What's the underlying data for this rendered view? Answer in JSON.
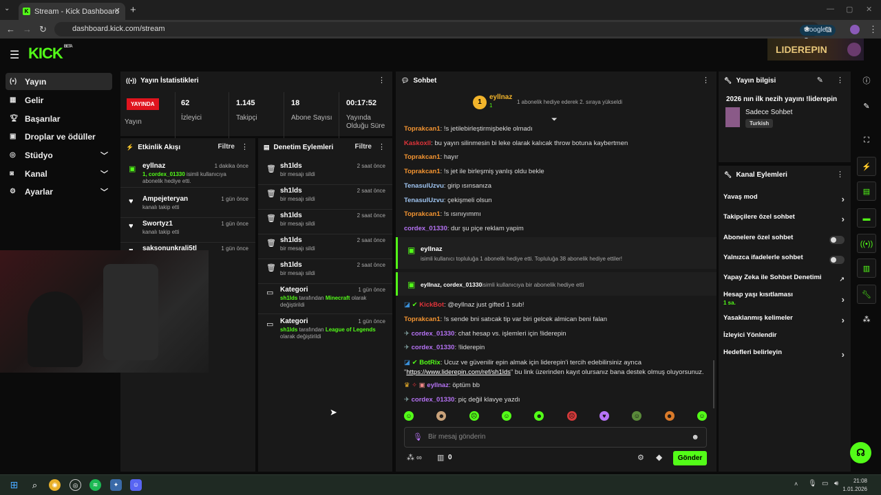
{
  "browser": {
    "tab_title": "Stream - Kick Dashboard",
    "url": "dashboard.kick.com/stream",
    "google_sor": "Google'a Sor"
  },
  "app": {
    "logo": "KICK",
    "logo_beta": "BETA",
    "banner": "LIDEREPIN"
  },
  "sidebar": {
    "items": [
      {
        "label": "Yayın",
        "icon": "broadcast-icon"
      },
      {
        "label": "Gelir",
        "icon": "revenue-icon"
      },
      {
        "label": "Başarılar",
        "icon": "trophy-icon"
      },
      {
        "label": "Droplar ve ödüller",
        "icon": "gift-icon"
      },
      {
        "label": "Stüdyo",
        "icon": "studio-icon"
      },
      {
        "label": "Kanal",
        "icon": "channel-icon"
      },
      {
        "label": "Ayarlar",
        "icon": "gear-icon"
      }
    ]
  },
  "stats": {
    "title": "Yayın İstatistikleri",
    "live_badge": "YAYINDA",
    "live_label": "Yayın",
    "viewers": "62",
    "viewers_label": "İzleyici",
    "followers": "1.145",
    "followers_label": "Takipçi",
    "subs": "18",
    "subs_label": "Abone Sayısı",
    "duration": "00:17:52",
    "duration_label": "Yayında Olduğu Süre"
  },
  "activity": {
    "title": "Etkinlik Akışı",
    "filter": "Filtre",
    "items": [
      {
        "name": "eyllnaz",
        "time": "1 dakika önce",
        "hl": "1, cordex_01330",
        "desc": " isimli kullanıcıya abonelik hediye etti."
      },
      {
        "name": "Ampejeteryan",
        "time": "1 gün önce",
        "hl": "",
        "desc": "kanalı takip etti"
      },
      {
        "name": "Swortyz1",
        "time": "1 gün önce",
        "hl": "",
        "desc": "kanalı takip etti"
      },
      {
        "name": "saksonunkrali5tl",
        "time": "1 gün önce",
        "hl": "",
        "desc": ""
      }
    ]
  },
  "moderation": {
    "title": "Denetim Eylemleri",
    "filter": "Filtre",
    "items": [
      {
        "name": "sh1lds",
        "time": "2 saat önce",
        "desc": "bir mesajı sildi"
      },
      {
        "name": "sh1lds",
        "time": "2 saat önce",
        "desc": "bir mesajı sildi"
      },
      {
        "name": "sh1lds",
        "time": "2 saat önce",
        "desc": "bir mesajı sildi"
      },
      {
        "name": "sh1lds",
        "time": "2 saat önce",
        "desc": "bir mesajı sildi"
      },
      {
        "name": "sh1lds",
        "time": "2 saat önce",
        "desc": "bir mesajı sildi"
      }
    ],
    "categories": [
      {
        "name": "Kategori",
        "time": "1 gün önce",
        "user": "sh1lds",
        "mid": " tarafından ",
        "game": "Minecraft",
        "end": " olarak değiştirildi"
      },
      {
        "name": "Kategori",
        "time": "1 gün önce",
        "user": "sh1lds",
        "mid": " tarafından ",
        "game": "League of Legends",
        "end": " olarak değiştirildi"
      }
    ]
  },
  "chat": {
    "title": "Sohbet",
    "pinned_rank": "1",
    "pinned_user": "eyllnaz",
    "pinned_sub": "1",
    "pinned_text": "1 abonelik hediye ederek 2. sıraya yükseldi",
    "messages": [
      {
        "user": "Toprakcan1",
        "cls": "u-orange",
        "text": ": !s jetilebirleştirmişbekle olmadı"
      },
      {
        "user": "Kaskoxll",
        "cls": "u-red",
        "text": ": bu yayın silinmesin bi leke olarak kalıcak throw botuna kaybertmen"
      },
      {
        "user": "Toprakcan1",
        "cls": "u-orange",
        "text": ": hayır"
      },
      {
        "user": "Toprakcan1",
        "cls": "u-orange",
        "text": ": !s jet ile birleşmiş yanlış oldu bekle"
      },
      {
        "user": "TenasulUzvu",
        "cls": "u-blue",
        "text": ": girip ısınsanıza"
      },
      {
        "user": "TenasulUzvu",
        "cls": "u-blue",
        "text": ": çekişmeli olsun"
      },
      {
        "user": "Toprakcan1",
        "cls": "u-orange",
        "text": ": !s ısınıyımmı"
      },
      {
        "user": "cordex_01330",
        "cls": "u-purple",
        "text": ": dur şu piçe reklam yapim"
      }
    ],
    "gift1_user": "eyllnaz",
    "gift1_text": "isimli kullanıcı topluluğa 1 abonelik hediye etti. Topluluğa 38 abonelik hediye ettiler!",
    "gift2_users": "eyllnaz, cordex_01330",
    "gift2_text": " isimli kullanıcıya bir abonelik hediye etti",
    "messages2": [
      {
        "user": "KickBot",
        "cls": "u-red",
        "text": ": @eyllnaz just gifted 1 sub!"
      },
      {
        "user": "Toprakcan1",
        "cls": "u-orange",
        "text": ": !s sende bni satıcak tip var biri gelcek almican beni falan"
      },
      {
        "user": "cordex_01330",
        "cls": "u-purple",
        "text": ": chat hesap vs. işlemleri için !liderepin"
      },
      {
        "user": "cordex_01330",
        "cls": "u-purple",
        "text": ": !liderepin"
      }
    ],
    "botrix_user": "BotRix",
    "botrix_text1": ": Ucuz ve güvenilir epin almak için liderepin'i tercih edebilirsiniz ayrıca",
    "botrix_link": "https://www.liderepin.com/ref/sh1lds",
    "botrix_text2": "\" bu link üzerinden kayıt olursanız bana destek olmuş oluyorsunuz.",
    "messages3": [
      {
        "user": "eyllnaz",
        "cls": "u-purple",
        "text": ": öptüm bb"
      },
      {
        "user": "cordex_01330",
        "cls": "u-purple",
        "text": ": piç değil klavye yazdı"
      }
    ],
    "input_placeholder": "Bir mesaj gönderin",
    "points": "0",
    "send": "Gönder"
  },
  "stream_info": {
    "title": "Yayın bilgisi",
    "stream_title": "2026 nın ilk nezih yayını !liderepin",
    "category": "Sadece Sohbet",
    "language": "Turkish"
  },
  "channel_actions": {
    "title": "Kanal Eylemleri",
    "items": [
      {
        "label": "Yavaş mod",
        "type": "arrow",
        "sub": ""
      },
      {
        "label": "Takipçilere özel sohbet",
        "type": "arrow",
        "sub": ""
      },
      {
        "label": "Abonelere özel sohbet",
        "type": "toggle",
        "sub": ""
      },
      {
        "label": "Yalnızca ifadelerle sohbet",
        "type": "toggle",
        "sub": ""
      },
      {
        "label": "Yapay Zeka ile Sohbet Denetimi",
        "type": "ext",
        "sub": ""
      },
      {
        "label": "Hesap yaşı kısıtlaması",
        "type": "arrow",
        "sub": "1 sa."
      },
      {
        "label": "Yasaklanmış kelimeler",
        "type": "arrow",
        "sub": ""
      },
      {
        "label": "İzleyici Yönlendir",
        "type": "none",
        "sub": ""
      },
      {
        "label": "Hedefleri belirleyin",
        "type": "arrow",
        "sub": ""
      }
    ]
  },
  "taskbar": {
    "time": "21:08",
    "date": "1.01.2026"
  }
}
